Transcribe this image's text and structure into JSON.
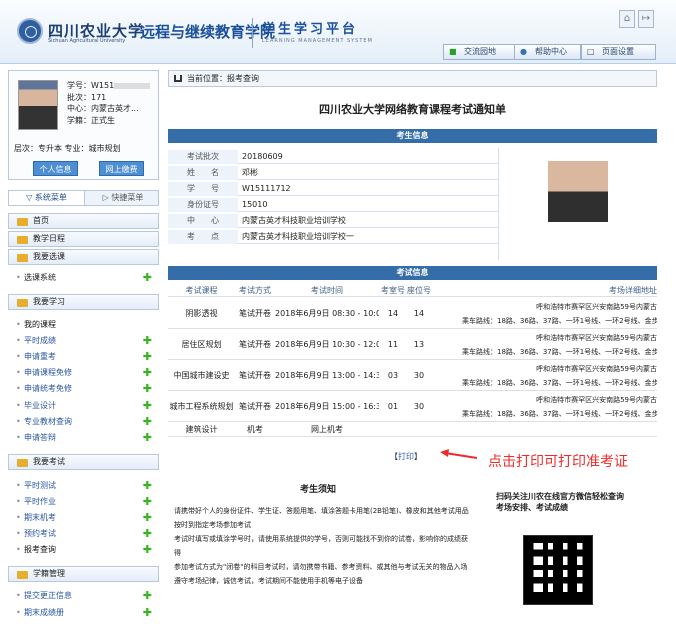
{
  "header": {
    "school_cn": "四川农业大学",
    "school_en": "Sichuan Agricultural University",
    "college": "远程与继续教育学院",
    "platform": "学生学习平台",
    "platform_en": "LEARNING MANAGEMENT SYSTEM",
    "links": [
      {
        "label": "交流园地",
        "icon": "chat-icon"
      },
      {
        "label": "帮助中心",
        "icon": "user-help-icon"
      },
      {
        "label": "页面设置",
        "icon": "page-settings-icon"
      }
    ]
  },
  "profile": {
    "id_label": "学号：",
    "id_value": "W151",
    "batch_label": "批次：",
    "batch_value": "171",
    "center_label": "中心：",
    "center_value": "内蒙古英才...",
    "status_label": "学籍：",
    "status_value": "正式生",
    "level_label": "层次：",
    "level_value": "专升本",
    "major_label": "专业：",
    "major_value": "城市规划",
    "btn_info": "个人信息",
    "btn_pay": "网上缴费"
  },
  "menu": {
    "tab_system": "系统菜单",
    "tab_quick": "快捷菜单",
    "home": "首页",
    "schedule": "教学日程",
    "course_select": "我要选课",
    "select_system": "选课系统",
    "study": "我要学习",
    "study_items": [
      "我的课程",
      "平时成绩",
      "申请重考",
      "申请课程免修",
      "申请统考免修",
      "毕业设计",
      "专业教材查询",
      "申请答辩"
    ],
    "exam": "我要考试",
    "exam_items": [
      "平时测试",
      "平时作业",
      "期末机考",
      "预约考试",
      "报考查询"
    ],
    "roll": "学籍管理",
    "roll_items": [
      "提交更正信息",
      "期末成绩册"
    ]
  },
  "main": {
    "breadcrumb_label": "当前位置：",
    "breadcrumb_value": "报考查询",
    "title": "四川农业大学网络教育课程考试通知单",
    "student_info": "考生信息",
    "info": [
      {
        "label": "考试批次",
        "value": "20180609"
      },
      {
        "label": "姓　　名",
        "value": "邓彬"
      },
      {
        "label": "学　　号",
        "value": "W15111712"
      },
      {
        "label": "身份证号",
        "value": "15010"
      },
      {
        "label": "中　　心",
        "value": "内蒙古英才科技职业培训学校"
      },
      {
        "label": "考　　点",
        "value": "内蒙古英才科技职业培训学校一"
      }
    ],
    "exam_info": "考试信息",
    "headers": [
      "考试课程",
      "考试方式",
      "考试时间",
      "考室号",
      "座位号",
      "考场详细地址"
    ],
    "rows": [
      {
        "course": "阴影透视",
        "method": "笔试开卷",
        "time": "2018年6月9日 08:30 - 10:00",
        "room": "14",
        "seat": "14",
        "addr1": "呼和浩特市赛罕区兴安南路59号内蒙古",
        "addr2": "乘车路线：18路、36路、37路、一环1号线、一环2号线、金步大"
      },
      {
        "course": "居住区规划",
        "method": "笔试开卷",
        "time": "2018年6月9日 10:30 - 12:00",
        "room": "11",
        "seat": "13",
        "addr1": "呼和浩特市赛罕区兴安南路59号内蒙古",
        "addr2": "乘车路线：18路、36路、37路、一环1号线、一环2号线、金步大"
      },
      {
        "course": "中国城市建设史",
        "method": "笔试开卷",
        "time": "2018年6月9日 13:00 - 14:30",
        "room": "03",
        "seat": "30",
        "addr1": "呼和浩特市赛罕区兴安南路59号内蒙古",
        "addr2": "乘车路线：18路、36路、37路、一环1号线、一环2号线、金步大"
      },
      {
        "course": "城市工程系统规划",
        "method": "笔试开卷",
        "time": "2018年6月9日 15:00 - 16:30",
        "room": "01",
        "seat": "30",
        "addr1": "呼和浩特市赛罕区兴安南路59号内蒙古",
        "addr2": "乘车路线：18路、36路、37路、一环1号线、一环2号线、金步大"
      },
      {
        "course": "建筑设计",
        "method": "机考",
        "time": "网上机考",
        "room": "",
        "seat": "",
        "addr1": "",
        "addr2": ""
      }
    ],
    "print_left": "【",
    "print": "打印",
    "print_right": "】",
    "annotation": "点击打印可打印准考证",
    "notice_title": "考生须知",
    "notice": [
      "请携带好个人的身份证件、学生证、答题用笔、填涂答题卡用笔(2B铅笔)、橡皮和其他考试用品按时到指定考场参加考试",
      "考试时填写或填涂学号时，请使用系统提供的学号，否则可能找不到你的试卷，影响你的成绩获得",
      "参加考试方式为\"闭卷\"的科目考试时，请勿携带书籍、参考资料、或其他与考试无关的物品入场",
      "遵守考场纪律，诚信考试，考试期间不能使用手机等电子设备"
    ],
    "qr_title": "扫码关注川农在线官方微信轻松查询考场安排、考试成绩"
  }
}
